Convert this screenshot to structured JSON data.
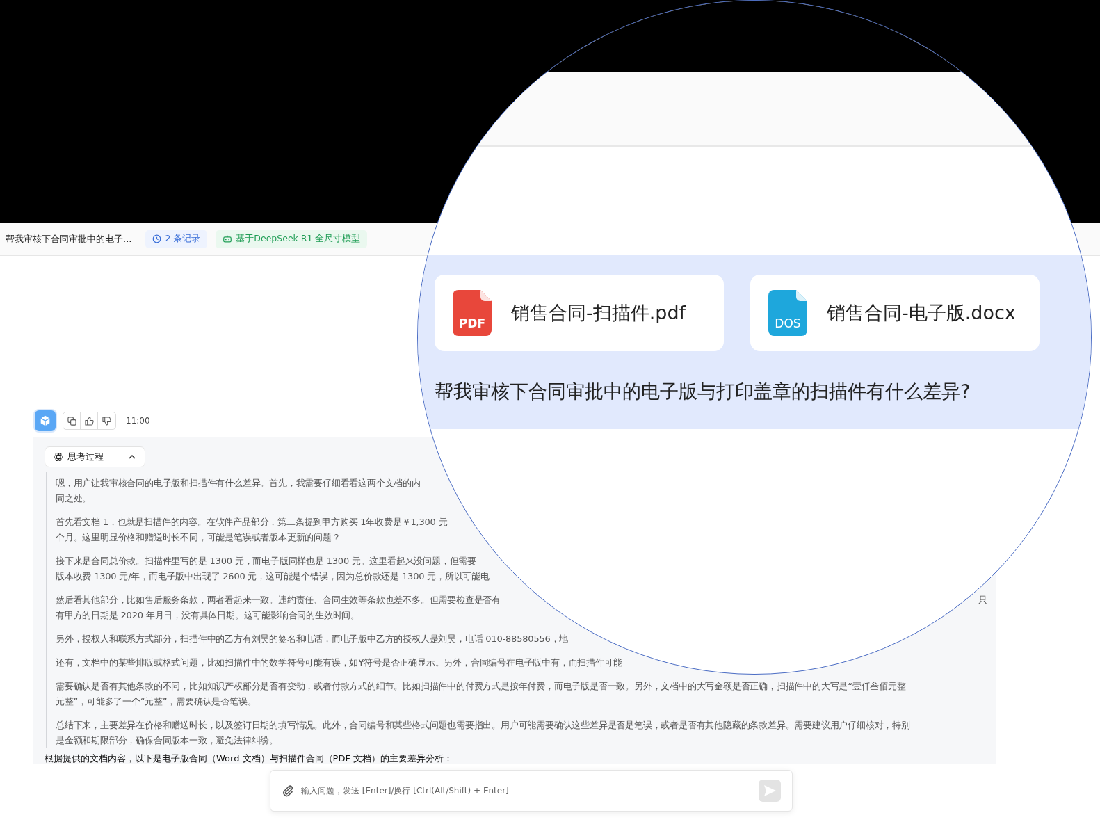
{
  "header": {
    "title": "帮我审核下合同审批中的电子...",
    "badges": [
      {
        "kind": "history",
        "label": "2 条记录"
      },
      {
        "kind": "model",
        "label": "基于DeepSeek R1 全尺寸模型"
      }
    ]
  },
  "message": {
    "time": "11:00"
  },
  "thinking": {
    "label": "思考过程",
    "expanded": true,
    "paragraphs": [
      {
        "lines": [
          {
            "left": "嗯，用户让我审核合同的电子版和扫描件有什么差异。首先，我需要仔细看看这两个文档的内"
          },
          {
            "left": "同之处。"
          }
        ]
      },
      {
        "lines": [
          {
            "left": "首先看文档 1，也就是扫描件的内容。在软件产品部分，第二条提到甲方购买 1年收费是￥1,300 元"
          },
          {
            "left": "个月。这里明显价格和赠送时长不同，可能是笔误或者版本更新的问题？"
          }
        ]
      },
      {
        "lines": [
          {
            "left": "接下来是合同总价款。扫描件里写的是 1300 元，而电子版同样也是 1300 元。这里看起来没问题，但需要"
          },
          {
            "left": "版本收费 1300 元/年，而电子版中出现了 2600 元，这可能是个错误，因为总价款还是 1300 元，所以可能电"
          }
        ]
      },
      {
        "lines": [
          {
            "left": "然后看其他部分，比如售后服务条款，两者看起来一致。违约责任、合同生效等条款也差不多。但需要检查是否有",
            "right": "只"
          },
          {
            "left": "有甲方的日期是 2020 年月日，没有具体日期。这可能影响合同的生效时间。"
          }
        ]
      },
      {
        "lines": [
          {
            "left": "另外，授权人和联系方式部分，扫描件中的乙方有刘昊的签名和电话，而电子版中乙方的授权人是刘昊，电话 010-88580556，地"
          }
        ]
      },
      {
        "lines": [
          {
            "left": "还有，文档中的某些排版或格式问题，比如扫描件中的数学符号可能有误，如¥符号是否正确显示。另外，合同编号在电子版中有，而扫描件可能"
          }
        ]
      },
      {
        "lines": [
          {
            "left": "需要确认是否有其他条款的不同，比如知识产权部分是否有变动，或者付款方式的细节。比如扫描件中的付费方式是按年付费，而电子版是否一致。另外，文档中的大写金额是否正确，扫描件中的大写是“壹仟叁佰元整"
          },
          {
            "left": "元整”，可能多了一个“元整”，需要确认是否笔误。"
          }
        ]
      },
      {
        "lines": [
          {
            "left": "总结下来，主要差异在价格和赠送时长，以及签订日期的填写情况。此外，合同编号和某些格式问题也需要指出。用户可能需要确认这些差异是否是笔误，或者是否有其他隐藏的条款差异。需要建议用户仔细核对，特别"
          },
          {
            "left": "是金额和期限部分，确保合同版本一致，避免法律纠纷。"
          }
        ]
      }
    ]
  },
  "answer_intro": "根据提供的文档内容，以下是电子版合同（Word 文档）与扫描件合同（PDF 文档）的主要差异分析：",
  "input": {
    "placeholder": "输入问题，发送 [Enter]/换行 [Ctrl(Alt/Shift) + Enter]"
  },
  "magnifier": {
    "files": [
      {
        "kind": "pdf",
        "icon_label": "PDF",
        "name": "销售合同-扫描件.pdf"
      },
      {
        "kind": "doc",
        "icon_label": "DOS",
        "name": "销售合同-电子版.docx"
      }
    ],
    "question": "帮我审核下合同审批中的电子版与打印盖章的扫描件有什么差异?"
  }
}
